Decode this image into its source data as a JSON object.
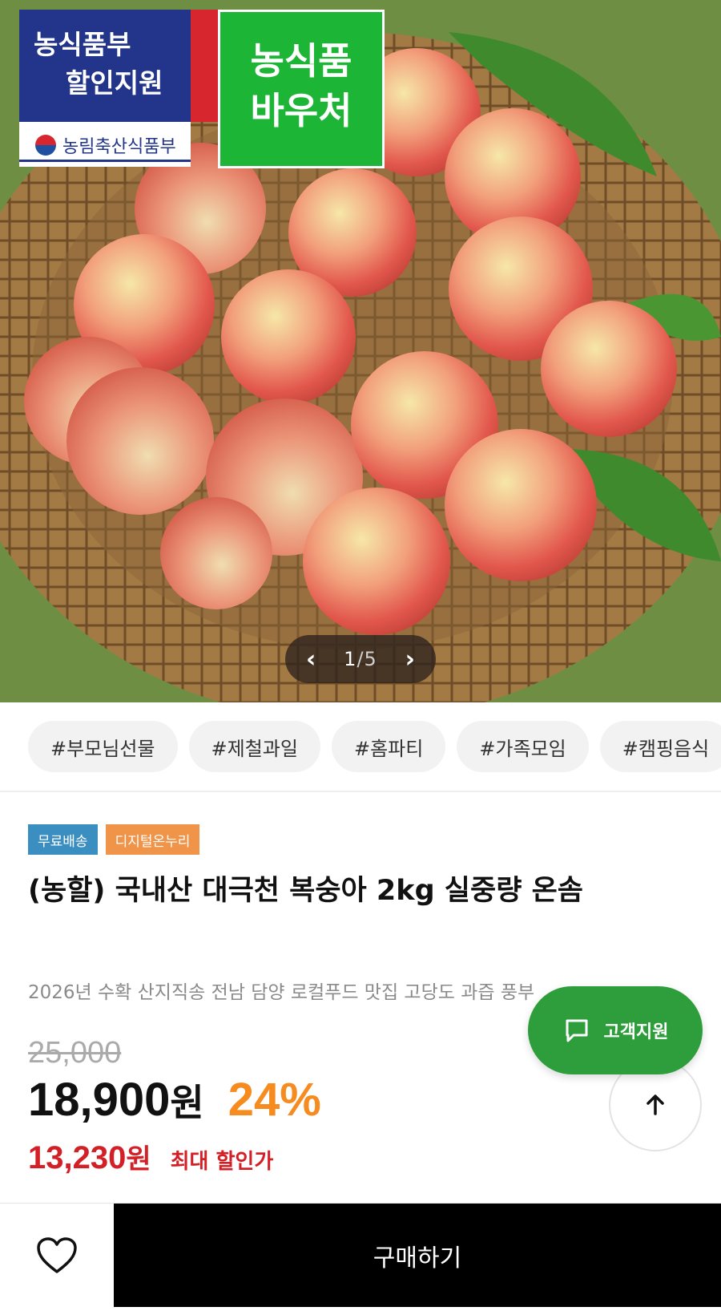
{
  "hero": {
    "badge_gov_line1": "농식품부",
    "badge_gov_line2": "할인지원",
    "ministry": "농림축산식품부",
    "voucher_line1": "농식품",
    "voucher_line2": "바우처",
    "pager_current": "1",
    "pager_total": "/5",
    "prev_icon": "chevron-left-icon",
    "next_icon": "chevron-right-icon"
  },
  "tags": [
    "#부모님선물",
    "#제철과일",
    "#홈파티",
    "#가족모임",
    "#캠핑음식"
  ],
  "labels": {
    "free_shipping": "무료배송",
    "digital_onnuri": "디지털온누리"
  },
  "product": {
    "title": "(농할) 국내산 대극천 복숭아 2kg 실중량 온솜",
    "subtitle": "2026년 수확 산지직송 전남 담양 로컬푸드 맛집 고당도 과즙 풍부",
    "original_price": "25,000",
    "price": "18,900",
    "price_unit": "원",
    "discount": "24%",
    "max_price": "13,230",
    "max_price_unit": "원",
    "max_label": "최대 할인가"
  },
  "floating": {
    "support_label": "고객지원",
    "support_icon": "chat-icon",
    "scroll_top_icon": "arrow-up-icon"
  },
  "bottom": {
    "wish_icon": "heart-icon",
    "buy_label": "구매하기"
  },
  "colors": {
    "accent_green": "#2e9e3c",
    "discount_orange": "#f68b1f",
    "max_price_red": "#d32027",
    "gov_blue": "#22358a",
    "voucher_green": "#1db535"
  }
}
